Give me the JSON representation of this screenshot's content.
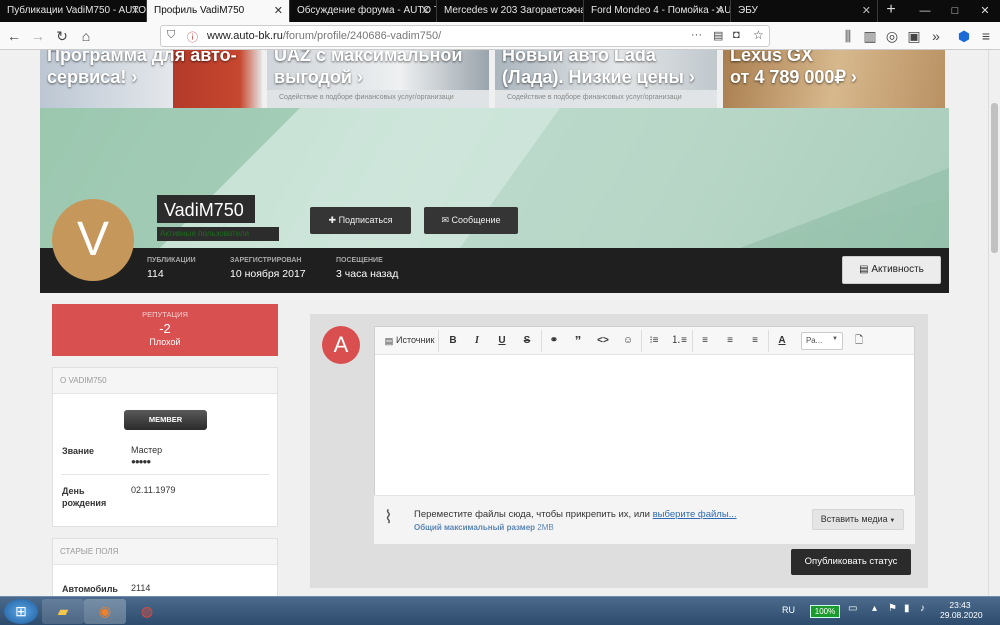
{
  "tabs": [
    {
      "label": "Публикации VadiM750 - AUTO"
    },
    {
      "label": "Профиль VadiM750",
      "active": true
    },
    {
      "label": "Обсуждение форума - AUTO Т"
    },
    {
      "label": "Mercedes w 203 Загорается на"
    },
    {
      "label": "Ford Mondeo 4 - Помойка - AU"
    },
    {
      "label": "ЭБУ"
    }
  ],
  "new_tab": "+",
  "window_controls": {
    "minimize": "—",
    "maximize": "□",
    "close": "✕"
  },
  "nav": {
    "url_domain": "www.auto-bk.ru",
    "url_path": "/forum/profile/240686-vadim750/",
    "more": "···"
  },
  "ads": [
    {
      "title_line1": "Программа для авто-",
      "title_line2": "сервиса! ›",
      "note": ""
    },
    {
      "title_line1": "UAZ с максимальной",
      "title_line2": "выгодой ›",
      "note": "Содействие в подборе финансовых услуг/организаци"
    },
    {
      "title_line1": "Новый авто Lada",
      "title_line2": "(Лада). Низкие цены ›",
      "note": "Содействие в подборе финансовых услуг/организаци"
    },
    {
      "title_line1": "Lexus GX",
      "title_line2": "от 4 789 000₽ ›",
      "note": ""
    }
  ],
  "profile": {
    "avatar_letter": "V",
    "username": "VadiM750",
    "role": "Активные пользователи",
    "follow_label": "Подписаться",
    "message_label": "Сообщение",
    "activity_label": "Активность",
    "stats": [
      {
        "label": "ПУБЛИКАЦИИ",
        "value": "114"
      },
      {
        "label": "ЗАРЕГИСТРИРОВАН",
        "value": "10 ноября 2017"
      },
      {
        "label": "ПОСЕЩЕНИЕ",
        "value": "3 часа назад"
      }
    ]
  },
  "reputation": {
    "label": "РЕПУТАЦИЯ",
    "value": "-2",
    "status": "Плохой"
  },
  "about": {
    "header": "О VADIM750",
    "badge": "MEMBER",
    "rank_label": "Звание",
    "rank_value": "Мастер",
    "rank_pips": "●●●●●",
    "birthday_label_1": "День",
    "birthday_label_2": "рождения",
    "birthday_value": "02.11.1979"
  },
  "old_fields": {
    "header": "СТАРЫЕ ПОЛЯ",
    "car_label": "Автомобиль",
    "car_value": "2114"
  },
  "composer": {
    "avatar_letter": "A",
    "source_label": "Источник",
    "font_size_label": "Ра...",
    "attach_text": "Переместите файлы сюда, чтобы прикрепить их, или ",
    "attach_link": "выберите файлы...",
    "max_size_label": "Общий максимальный размер",
    "max_size_value": "2MB",
    "insert_media": "Вставить медиа",
    "publish_label": "Опубликовать статус"
  },
  "taskbar": {
    "lang": "RU",
    "battery": "100%",
    "time": "23:43",
    "date": "29.08.2020"
  }
}
